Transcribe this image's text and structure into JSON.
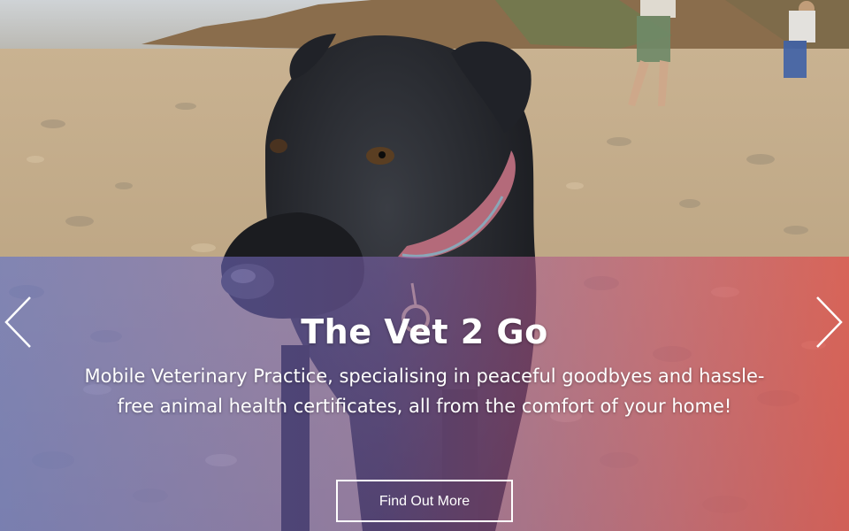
{
  "hero": {
    "title": "The Vet 2 Go",
    "subtitle": "Mobile Veterinary Practice, specialising in peaceful goodbyes and hassle-free animal health certificates, all from the comfort of your home!",
    "cta_label": "Find Out More",
    "image_icon": "dog-on-beach-photo",
    "prev_icon": "chevron-left-icon",
    "next_icon": "chevron-right-icon"
  },
  "colors": {
    "overlay_left": "#5c70ce",
    "overlay_right": "#e24846",
    "text": "#ffffff"
  }
}
